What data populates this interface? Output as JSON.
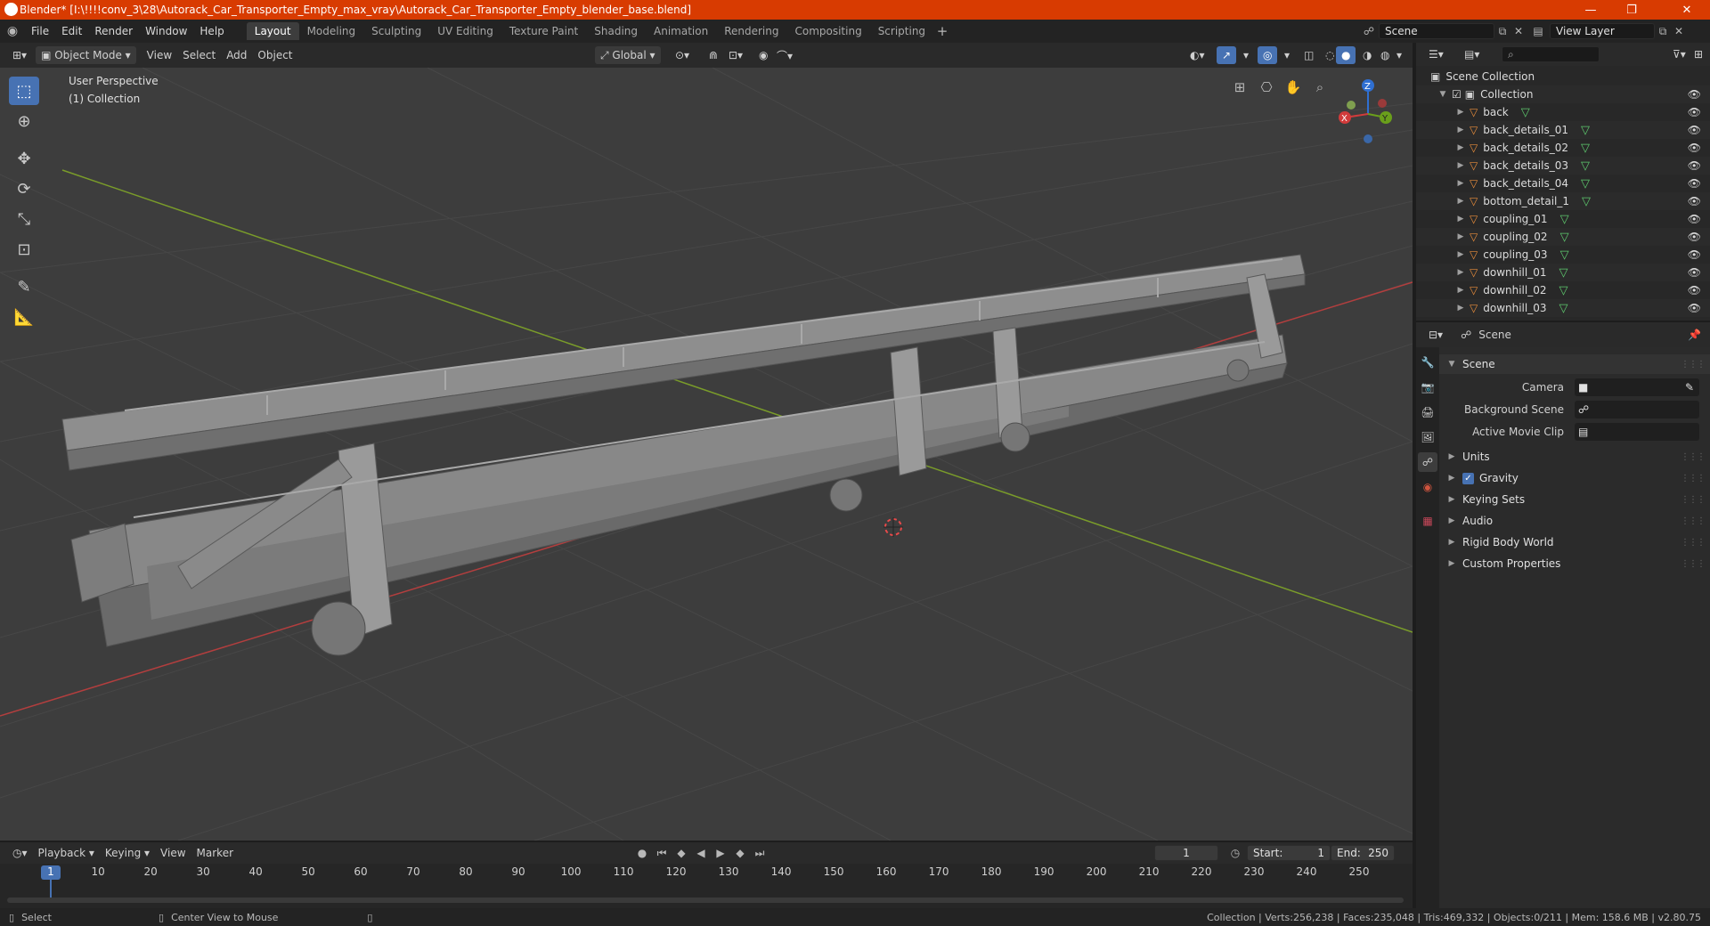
{
  "window": {
    "title": "Blender* [I:\\!!!!conv_3\\28\\Autorack_Car_Transporter_Empty_max_vray\\Autorack_Car_Transporter_Empty_blender_base.blend]",
    "minimize": "—",
    "maximize": "❐",
    "close": "✕"
  },
  "menu": [
    "File",
    "Edit",
    "Render",
    "Window",
    "Help"
  ],
  "workspaces": [
    "Layout",
    "Modeling",
    "Sculpting",
    "UV Editing",
    "Texture Paint",
    "Shading",
    "Animation",
    "Rendering",
    "Compositing",
    "Scripting"
  ],
  "active_workspace": "Layout",
  "scene_selector": {
    "value": "Scene"
  },
  "view_layer_selector": {
    "value": "View Layer"
  },
  "viewport_header": {
    "mode": "Object Mode",
    "menus": [
      "View",
      "Select",
      "Add",
      "Object"
    ],
    "orientation": "Global"
  },
  "viewport": {
    "perspective": "User Perspective",
    "collection": "(1) Collection",
    "gizmo": {
      "x": "X",
      "y": "Y",
      "z": "Z"
    },
    "colors": {
      "background": "#3d3d3d",
      "grid": "#474747",
      "x_axis": "#b33e3e",
      "y_axis": "#7a9c2a",
      "model": "#8c8c8c"
    }
  },
  "outliner": {
    "root": "Scene Collection",
    "collection": "Collection",
    "items": [
      "back",
      "back_details_01",
      "back_details_02",
      "back_details_03",
      "back_details_04",
      "bottom_detail_1",
      "coupling_01",
      "coupling_02",
      "coupling_03",
      "downhill_01",
      "downhill_02",
      "downhill_03"
    ]
  },
  "properties": {
    "header_title": "Scene",
    "panel_title": "Scene",
    "camera_label": "Camera",
    "background_scene_label": "Background Scene",
    "active_movie_clip_label": "Active Movie Clip",
    "sections": [
      "Units",
      "Gravity",
      "Keying Sets",
      "Audio",
      "Rigid Body World",
      "Custom Properties"
    ],
    "gravity_checked": true
  },
  "timeline": {
    "menus": [
      "Playback",
      "Keying",
      "View",
      "Marker"
    ],
    "current_frame": "1",
    "start_label": "Start:",
    "start": "1",
    "end_label": "End:",
    "end": "250",
    "ticks": [
      "1",
      "10",
      "20",
      "30",
      "40",
      "50",
      "60",
      "70",
      "80",
      "90",
      "100",
      "110",
      "120",
      "130",
      "140",
      "150",
      "160",
      "170",
      "180",
      "190",
      "200",
      "210",
      "220",
      "230",
      "240",
      "250"
    ]
  },
  "statusbar": {
    "select": "Select",
    "center_view": "Center View to Mouse",
    "stats": "Collection | Verts:256,238 | Faces:235,048 | Tris:469,332 | Objects:0/211 | Mem: 158.6 MB | v2.80.75"
  }
}
